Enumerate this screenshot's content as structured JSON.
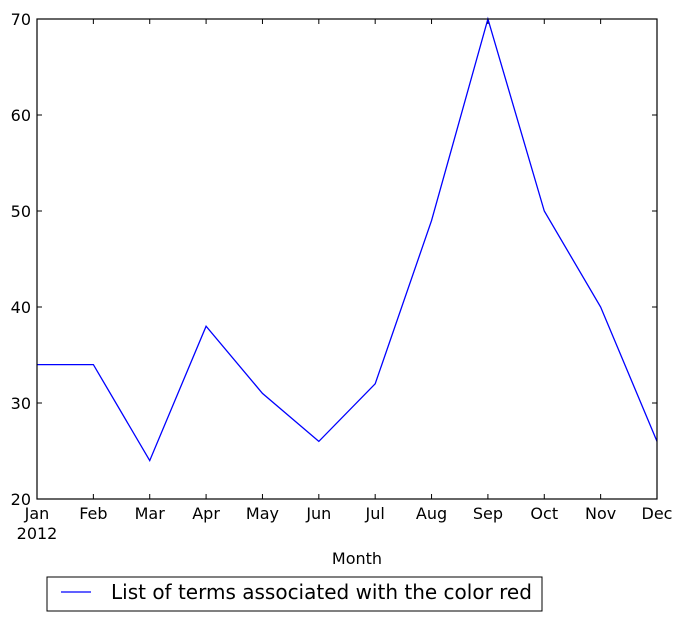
{
  "chart_data": {
    "type": "line",
    "title": "",
    "xlabel": "Month",
    "ylabel": "",
    "categories": [
      "Jan",
      "Feb",
      "Mar",
      "Apr",
      "May",
      "Jun",
      "Jul",
      "Aug",
      "Sep",
      "Oct",
      "Nov",
      "Dec"
    ],
    "x_sublabel": "2012",
    "series": [
      {
        "name": "List of terms associated with the color red",
        "color": "#0000ff",
        "values": [
          34,
          34,
          24,
          38,
          31,
          26,
          32,
          49,
          70,
          50,
          40,
          26
        ]
      }
    ],
    "ylim": [
      20,
      70
    ],
    "yticks": [
      20,
      30,
      40,
      50,
      60,
      70
    ],
    "grid": false,
    "legend": {
      "placement": "below-left",
      "entries": [
        "List of terms associated with the color red"
      ]
    }
  }
}
